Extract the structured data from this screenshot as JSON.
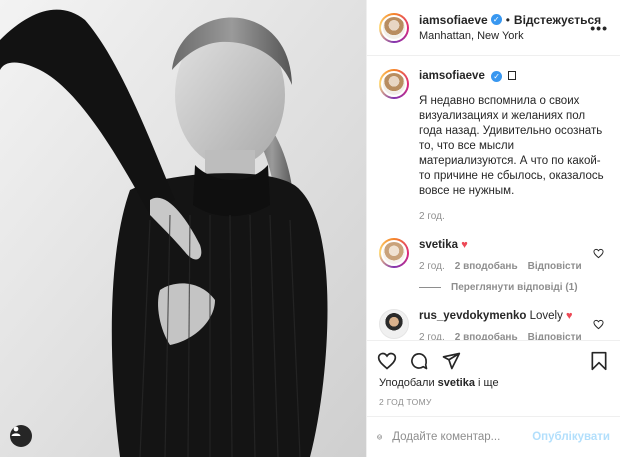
{
  "post": {
    "username": "iamsofiaeve",
    "follow_label": "Відстежується",
    "dot": "•",
    "location": "Manhattan, New York",
    "more_label": "•••"
  },
  "caption": {
    "username": "iamsofiaeve",
    "text": "Я недавно вспомнила о своих визуализациях и желаниях пол года назад. Удивительно осознать то, что все мысли материализуются. А что по какой-то причине не сбылось, оказалось вовсе не нужным.",
    "time": "2 год."
  },
  "comments": [
    {
      "username": "svetika",
      "text": "",
      "emoji": "♥",
      "time": "2 год.",
      "likes": "2 вподобань",
      "reply": "Відповісти"
    },
    {
      "username": "rus_yevdokymenko",
      "text": "Lovely",
      "emoji": "♥",
      "time": "2 год.",
      "likes": "2 вподобань",
      "reply": "Відповісти"
    }
  ],
  "view_replies": "Переглянути відповіді (1)",
  "likes_line": {
    "prefix": "Уподобали",
    "user": "svetika",
    "suffix": "і ще"
  },
  "post_time": "2 ГОД ТОМУ",
  "composer": {
    "placeholder": "Додайте коментар...",
    "publish_label": "Опублікувати"
  },
  "colors": {
    "verified": "#3897f0",
    "heart": "#ed4956",
    "publish_disabled": "#b2dffc"
  }
}
